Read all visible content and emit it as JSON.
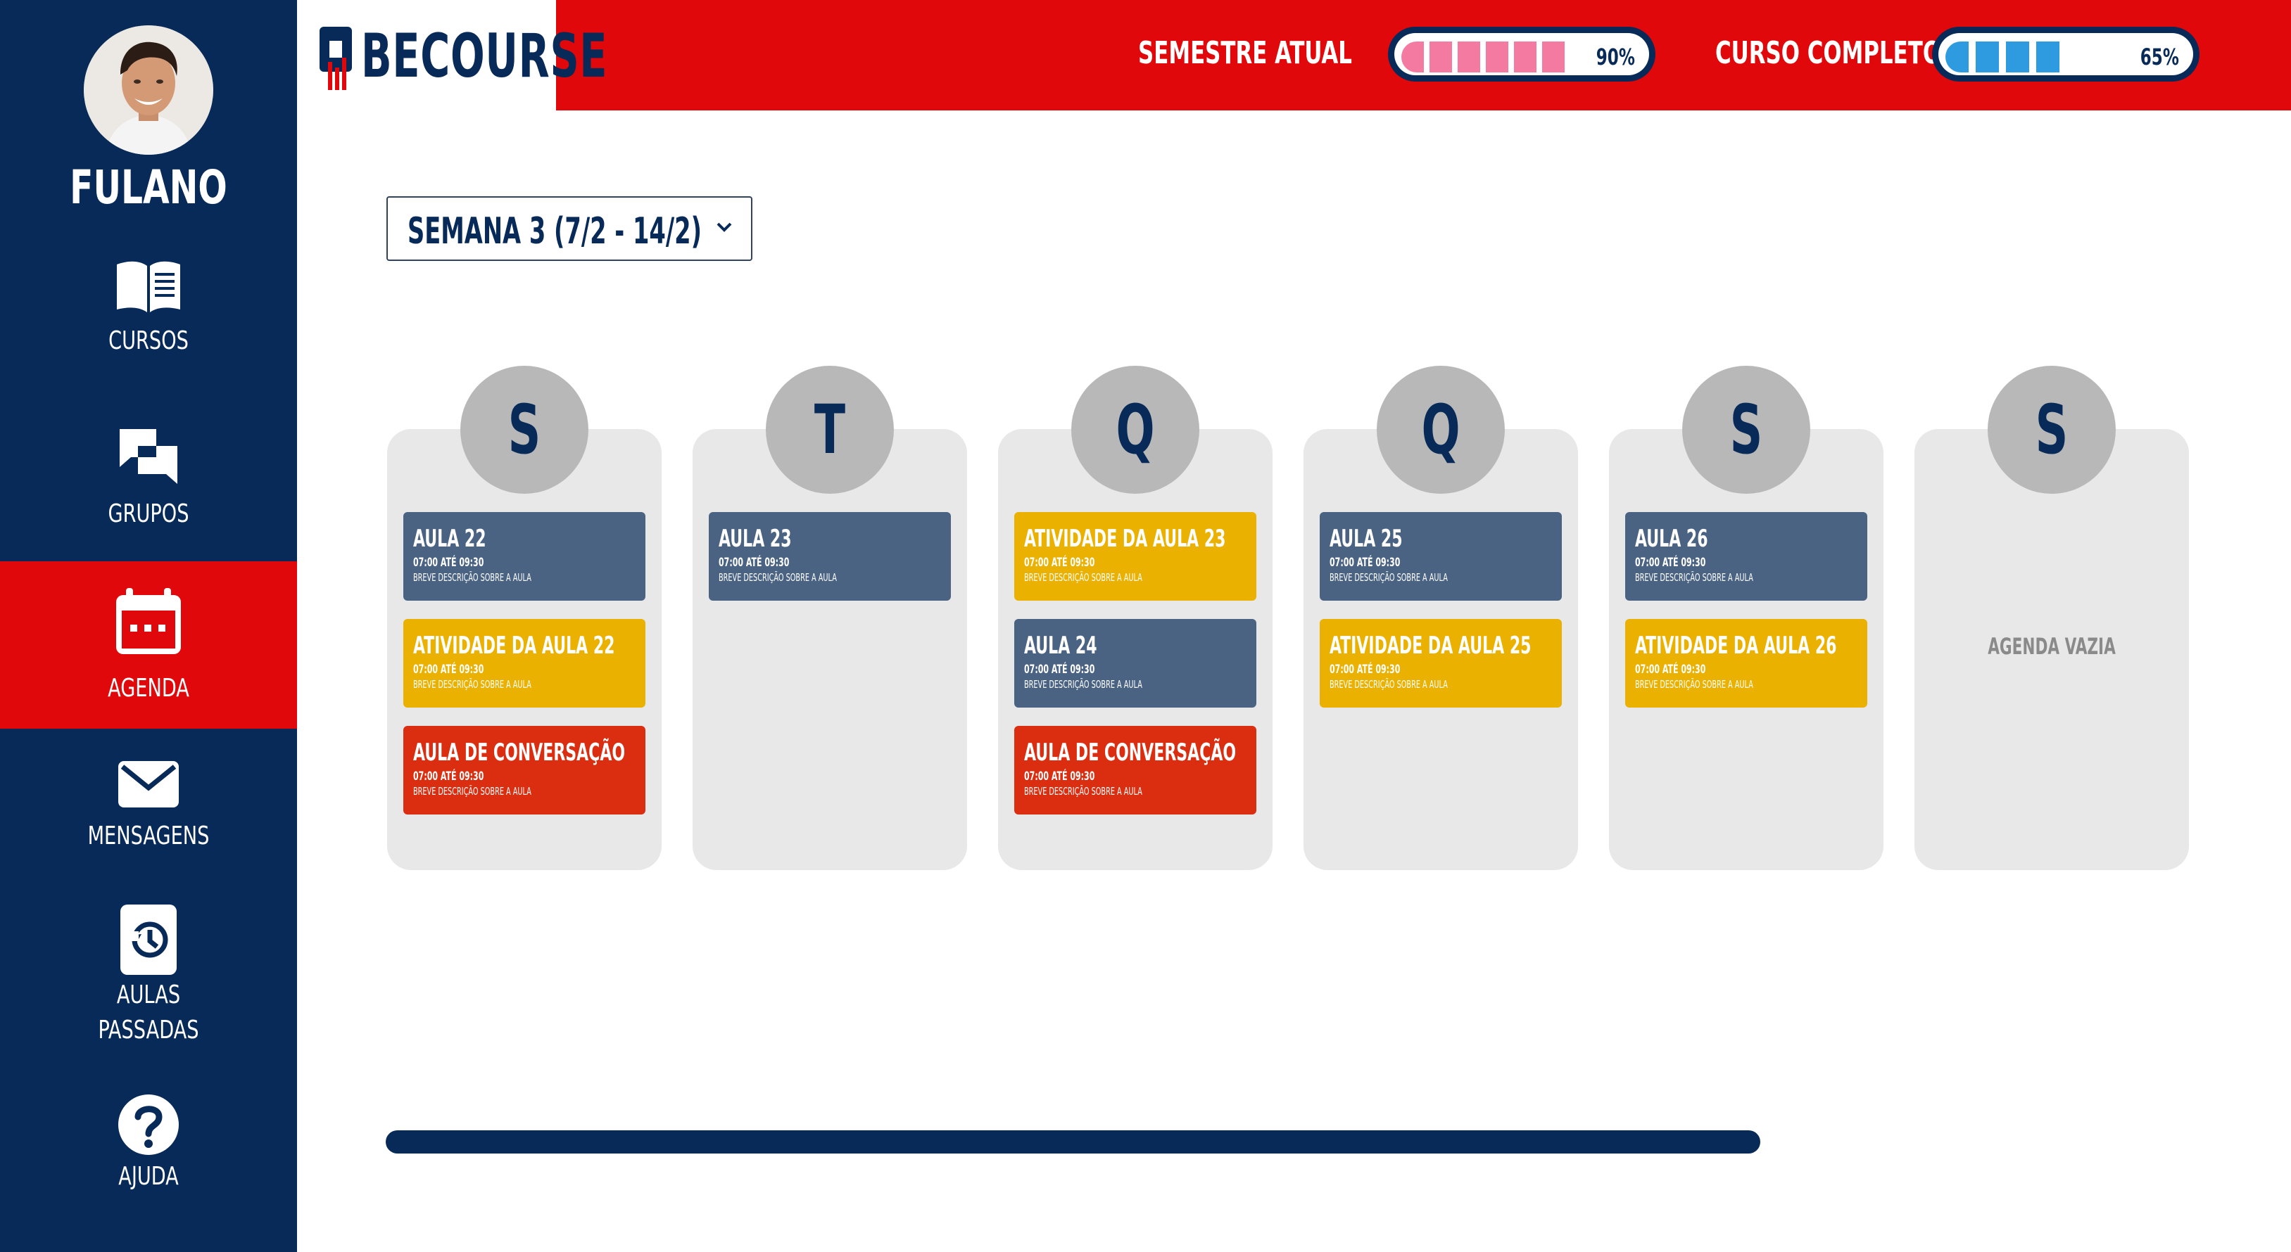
{
  "colors": {
    "navy": "#072a58",
    "red": "#e1080b",
    "lesson": "#4a6383",
    "activity": "#ebb100",
    "conversation": "#db2d10",
    "pink": "#f47aa2",
    "blue": "#2e9be0"
  },
  "sidebar": {
    "user_name": "FULANO",
    "items": [
      {
        "label": "CURSOS",
        "icon": "book-icon"
      },
      {
        "label": "GRUPOS",
        "icon": "chat-bubbles-icon"
      },
      {
        "label": "AGENDA",
        "icon": "calendar-icon",
        "active": true
      },
      {
        "label": "MENSAGENS",
        "icon": "envelope-icon"
      },
      {
        "label": "AULAS",
        "label2": "PASSADAS",
        "icon": "history-icon"
      },
      {
        "label": "AJUDA",
        "icon": "question-icon"
      }
    ]
  },
  "header": {
    "logo": "BECOURSE",
    "semester": {
      "label": "SEMESTRE ATUAL",
      "value": "90%",
      "progress": 0.9
    },
    "course": {
      "label": "CURSO COMPLETO",
      "value": "65%",
      "progress": 0.65
    }
  },
  "week_selector": {
    "label": "SEMANA 3 (7/2 - 14/2)"
  },
  "days": [
    {
      "letter": "S",
      "cards": [
        {
          "type": "lesson",
          "title": "AULA 22",
          "time": "07:00 ATÉ 09:30",
          "desc": "BREVE DESCRIÇÃO SOBRE A AULA"
        },
        {
          "type": "activity",
          "title": "ATIVIDADE DA AULA 22",
          "time": "07:00 ATÉ 09:30",
          "desc": "BREVE DESCRIÇÃO SOBRE A AULA"
        },
        {
          "type": "conversation",
          "title": "AULA DE CONVERSAÇÃO",
          "time": "07:00 ATÉ 09:30",
          "desc": "BREVE DESCRIÇÃO SOBRE A AULA"
        }
      ]
    },
    {
      "letter": "T",
      "cards": [
        {
          "type": "lesson",
          "title": "AULA 23",
          "time": "07:00 ATÉ 09:30",
          "desc": "BREVE DESCRIÇÃO SOBRE A AULA"
        }
      ]
    },
    {
      "letter": "Q",
      "cards": [
        {
          "type": "activity",
          "title": "ATIVIDADE DA AULA 23",
          "time": "07:00 ATÉ 09:30",
          "desc": "BREVE DESCRIÇÃO SOBRE A AULA"
        },
        {
          "type": "lesson",
          "title": "AULA 24",
          "time": "07:00 ATÉ 09:30",
          "desc": "BREVE DESCRIÇÃO SOBRE A AULA"
        },
        {
          "type": "conversation",
          "title": "AULA DE CONVERSAÇÃO",
          "time": "07:00 ATÉ 09:30",
          "desc": "BREVE DESCRIÇÃO SOBRE A AULA"
        }
      ]
    },
    {
      "letter": "Q",
      "cards": [
        {
          "type": "lesson",
          "title": "AULA 25",
          "time": "07:00 ATÉ 09:30",
          "desc": "BREVE DESCRIÇÃO SOBRE A AULA"
        },
        {
          "type": "activity",
          "title": "ATIVIDADE DA AULA 25",
          "time": "07:00 ATÉ 09:30",
          "desc": "BREVE DESCRIÇÃO SOBRE A AULA"
        }
      ]
    },
    {
      "letter": "S",
      "cards": [
        {
          "type": "lesson",
          "title": "AULA 26",
          "time": "07:00 ATÉ 09:30",
          "desc": "BREVE DESCRIÇÃO SOBRE A AULA"
        },
        {
          "type": "activity",
          "title": "ATIVIDADE DA AULA 26",
          "time": "07:00 ATÉ 09:30",
          "desc": "BREVE DESCRIÇÃO SOBRE A AULA"
        }
      ]
    },
    {
      "letter": "S",
      "cards": [],
      "empty_label": "AGENDA VAZIA"
    }
  ]
}
